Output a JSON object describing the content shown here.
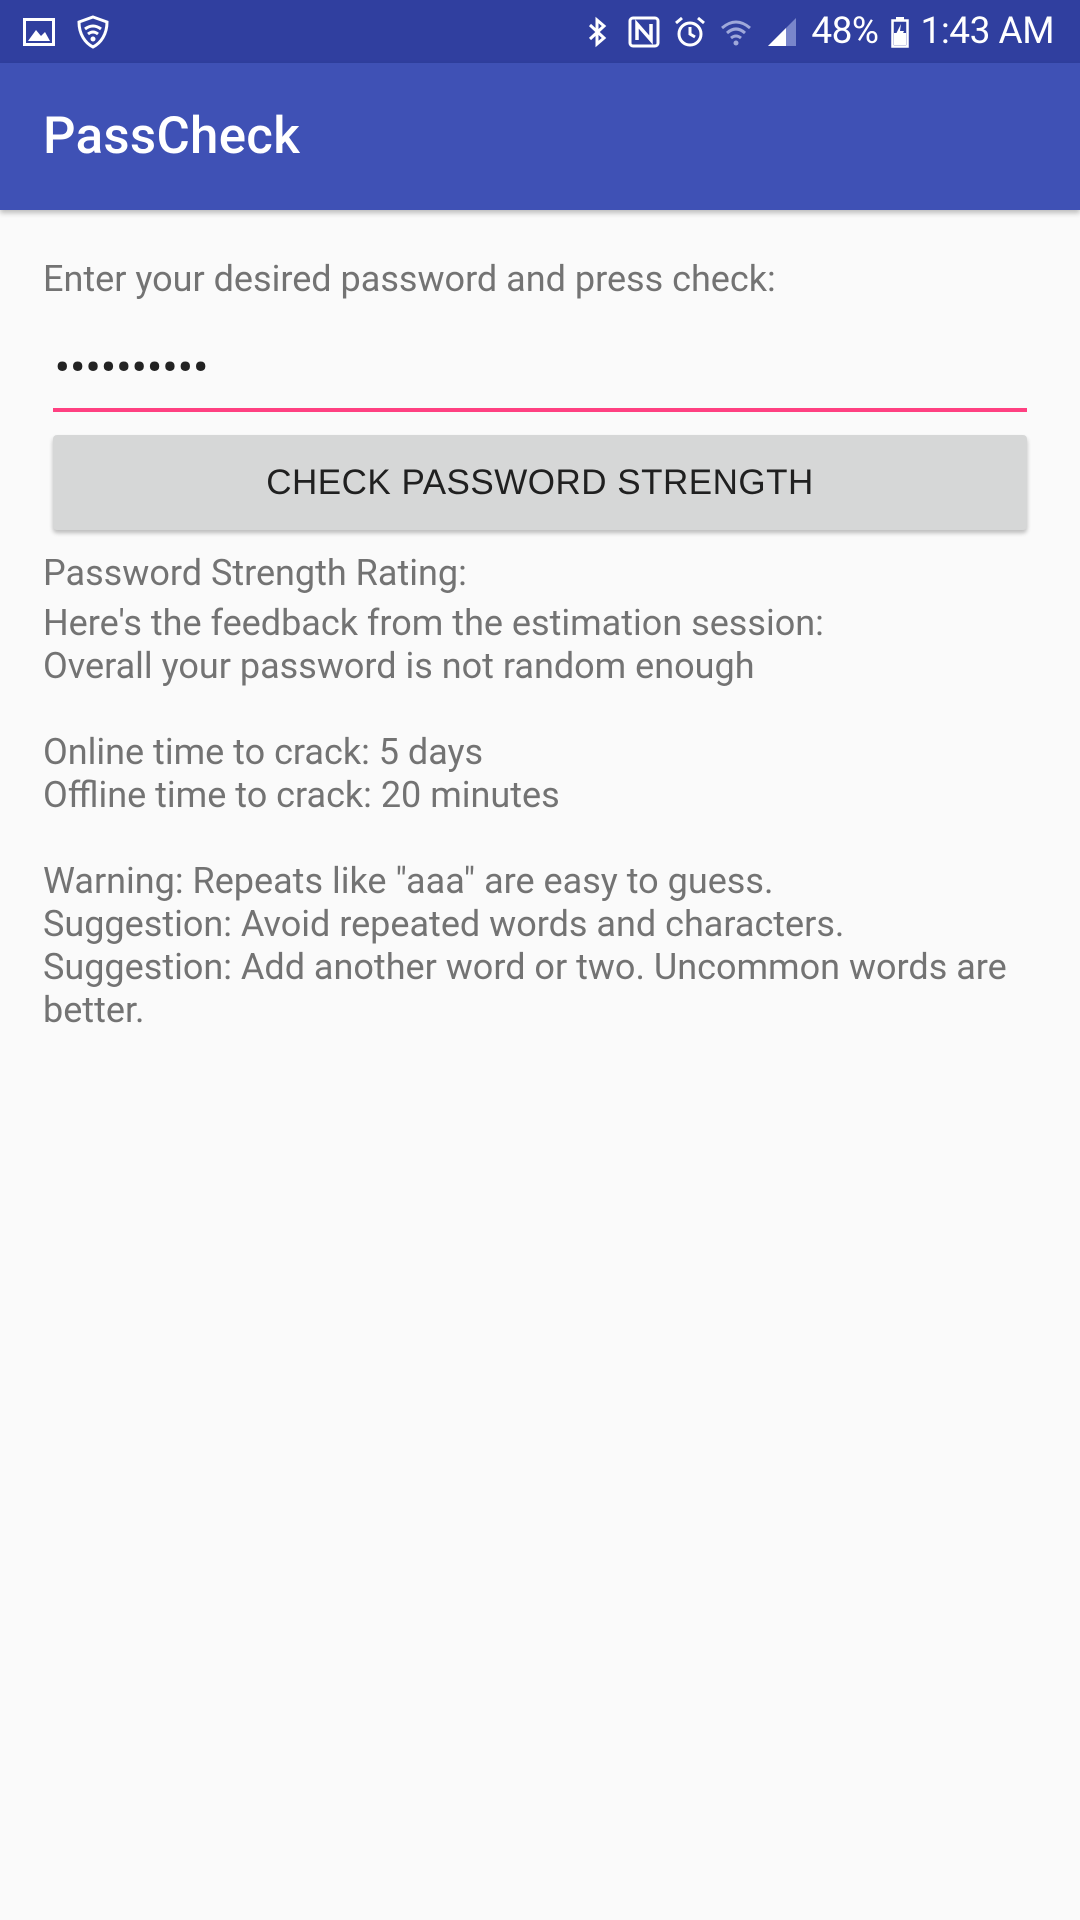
{
  "status_bar": {
    "left_icons": [
      "image-icon",
      "shield-wifi-icon"
    ],
    "right_icons": [
      "bluetooth-icon",
      "nfc-icon",
      "alarm-icon",
      "wifi-icon",
      "signal-icon"
    ],
    "battery_percent": "48%",
    "time": "1:43 AM"
  },
  "app_bar": {
    "title": "PassCheck"
  },
  "form": {
    "prompt": "Enter your desired password and press check:",
    "password_masked": "••••••••••",
    "check_button_label": "CHECK PASSWORD STRENGTH"
  },
  "result": {
    "rating_label": "Password Strength Rating:",
    "feedback_heading": "Here's the feedback from the estimation session:",
    "overall": "Overall your password is not random enough",
    "online_time": "Online time to crack: 5 days",
    "offline_time": "Offline time to crack: 20 minutes",
    "warning": "Warning: Repeats like \"aaa\" are easy to guess.",
    "suggestion_1": "Suggestion: Avoid repeated words and characters.",
    "suggestion_2": "Suggestion: Add another word or two. Uncommon words are better."
  },
  "colors": {
    "status_bar": "#303f9f",
    "app_bar": "#3f51b5",
    "accent": "#ff4081",
    "button": "#d6d7d7",
    "background": "#fafafa"
  }
}
